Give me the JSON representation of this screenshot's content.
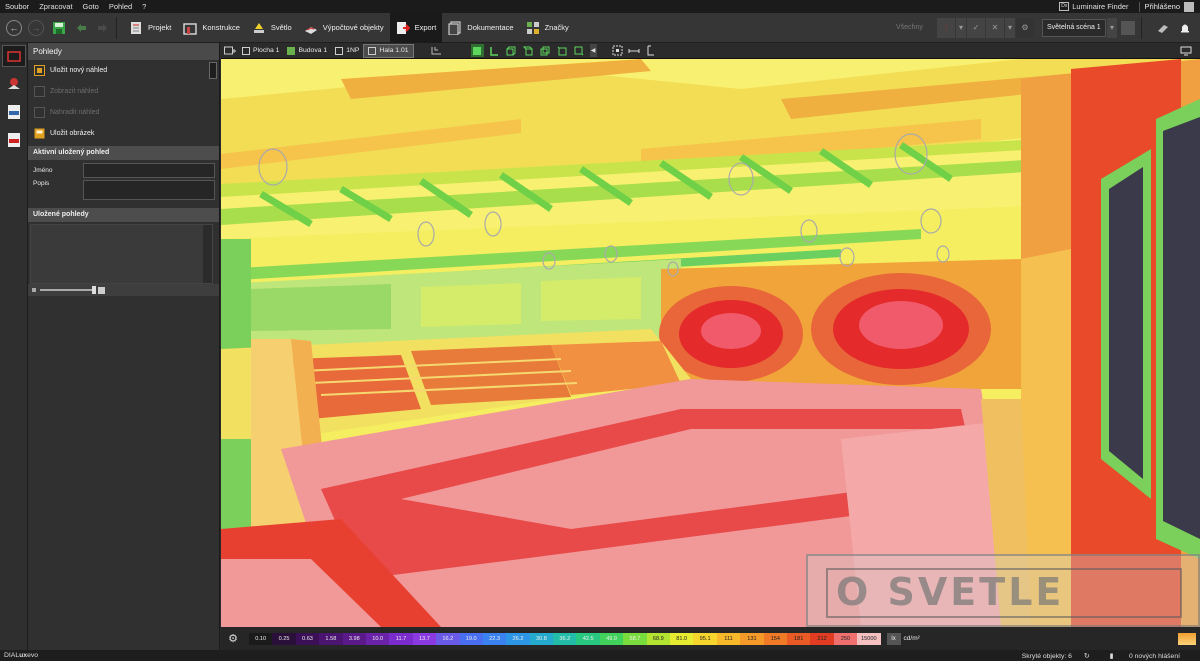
{
  "menu": {
    "items": [
      "Soubor",
      "Zpracovat",
      "Goto",
      "Pohled",
      "?"
    ],
    "luminaire_badge": "Dx",
    "luminaire_finder": "Luminaire Finder",
    "login": "Přihlášeno"
  },
  "toolbar": {
    "tabs": [
      {
        "label": "Projekt",
        "icon": "project-icon"
      },
      {
        "label": "Konstrukce",
        "icon": "construction-icon"
      },
      {
        "label": "Světlo",
        "icon": "light-icon"
      },
      {
        "label": "Výpočtové objekty",
        "icon": "calc-objects-icon"
      },
      {
        "label": "Export",
        "icon": "export-icon"
      },
      {
        "label": "Dokumentace",
        "icon": "documentation-icon"
      },
      {
        "label": "Značky",
        "icon": "labels-icon"
      }
    ],
    "active_tab": "Export",
    "filter_label": "Všechny",
    "scene_select": "Světelná scéna 1"
  },
  "panel": {
    "title": "Pohledy",
    "actions": [
      {
        "label": "Uložit nový náhled",
        "enabled": true,
        "icon": "save-view-icon"
      },
      {
        "label": "Zobrazit náhled",
        "enabled": false,
        "icon": "show-view-icon"
      },
      {
        "label": "Nahradit náhled",
        "enabled": false,
        "icon": "replace-view-icon"
      },
      {
        "label": "Uložit obrázek",
        "enabled": true,
        "icon": "save-image-icon"
      }
    ],
    "active_section": "Aktivní uložený pohled",
    "name_label": "Jméno",
    "desc_label": "Popis",
    "name_value": "",
    "desc_value": "",
    "saved_section": "Uložené pohledy"
  },
  "viewport": {
    "breadcrumbs": [
      {
        "label": "Plocha 1",
        "active": false
      },
      {
        "label": "Budova 1",
        "active": false
      },
      {
        "label": "1NP",
        "active": false
      },
      {
        "label": "Hala 1.01",
        "active": true
      }
    ],
    "watermark": "O SVETLE"
  },
  "legend": {
    "values": [
      "0.10",
      "0.25",
      "0.63",
      "1.58",
      "3.98",
      "10.0",
      "11.7",
      "13.7",
      "16.2",
      "19.0",
      "22.3",
      "26.2",
      "30.8",
      "36.2",
      "42.5",
      "49.9",
      "58.7",
      "68.9",
      "81.0",
      "95.1",
      "111",
      "131",
      "154",
      "181",
      "212",
      "250",
      "15000"
    ],
    "colors": [
      "#1a1a1a",
      "#2a0f3a",
      "#3b1056",
      "#4a1470",
      "#5a1a8a",
      "#6a22a8",
      "#7b2ccc",
      "#8a3ae0",
      "#6a5ae8",
      "#4a6ef0",
      "#3a82f0",
      "#2e96e6",
      "#24aacc",
      "#22bca8",
      "#28c880",
      "#40d25a",
      "#78dc3c",
      "#b4e432",
      "#e8ec30",
      "#f6d62c",
      "#f7b82a",
      "#f59a28",
      "#f07a26",
      "#ea5a24",
      "#e23c22",
      "#f07070",
      "#f4c0c0"
    ],
    "unit_button": "lx",
    "unit": "cd/m²"
  },
  "status": {
    "app_name_dia": "DIAL",
    "app_name_ux": "ux",
    "app_name_evo": "evo",
    "hidden_objects": "Skryté objekty: 6",
    "messages": "0 nových hlášení"
  }
}
